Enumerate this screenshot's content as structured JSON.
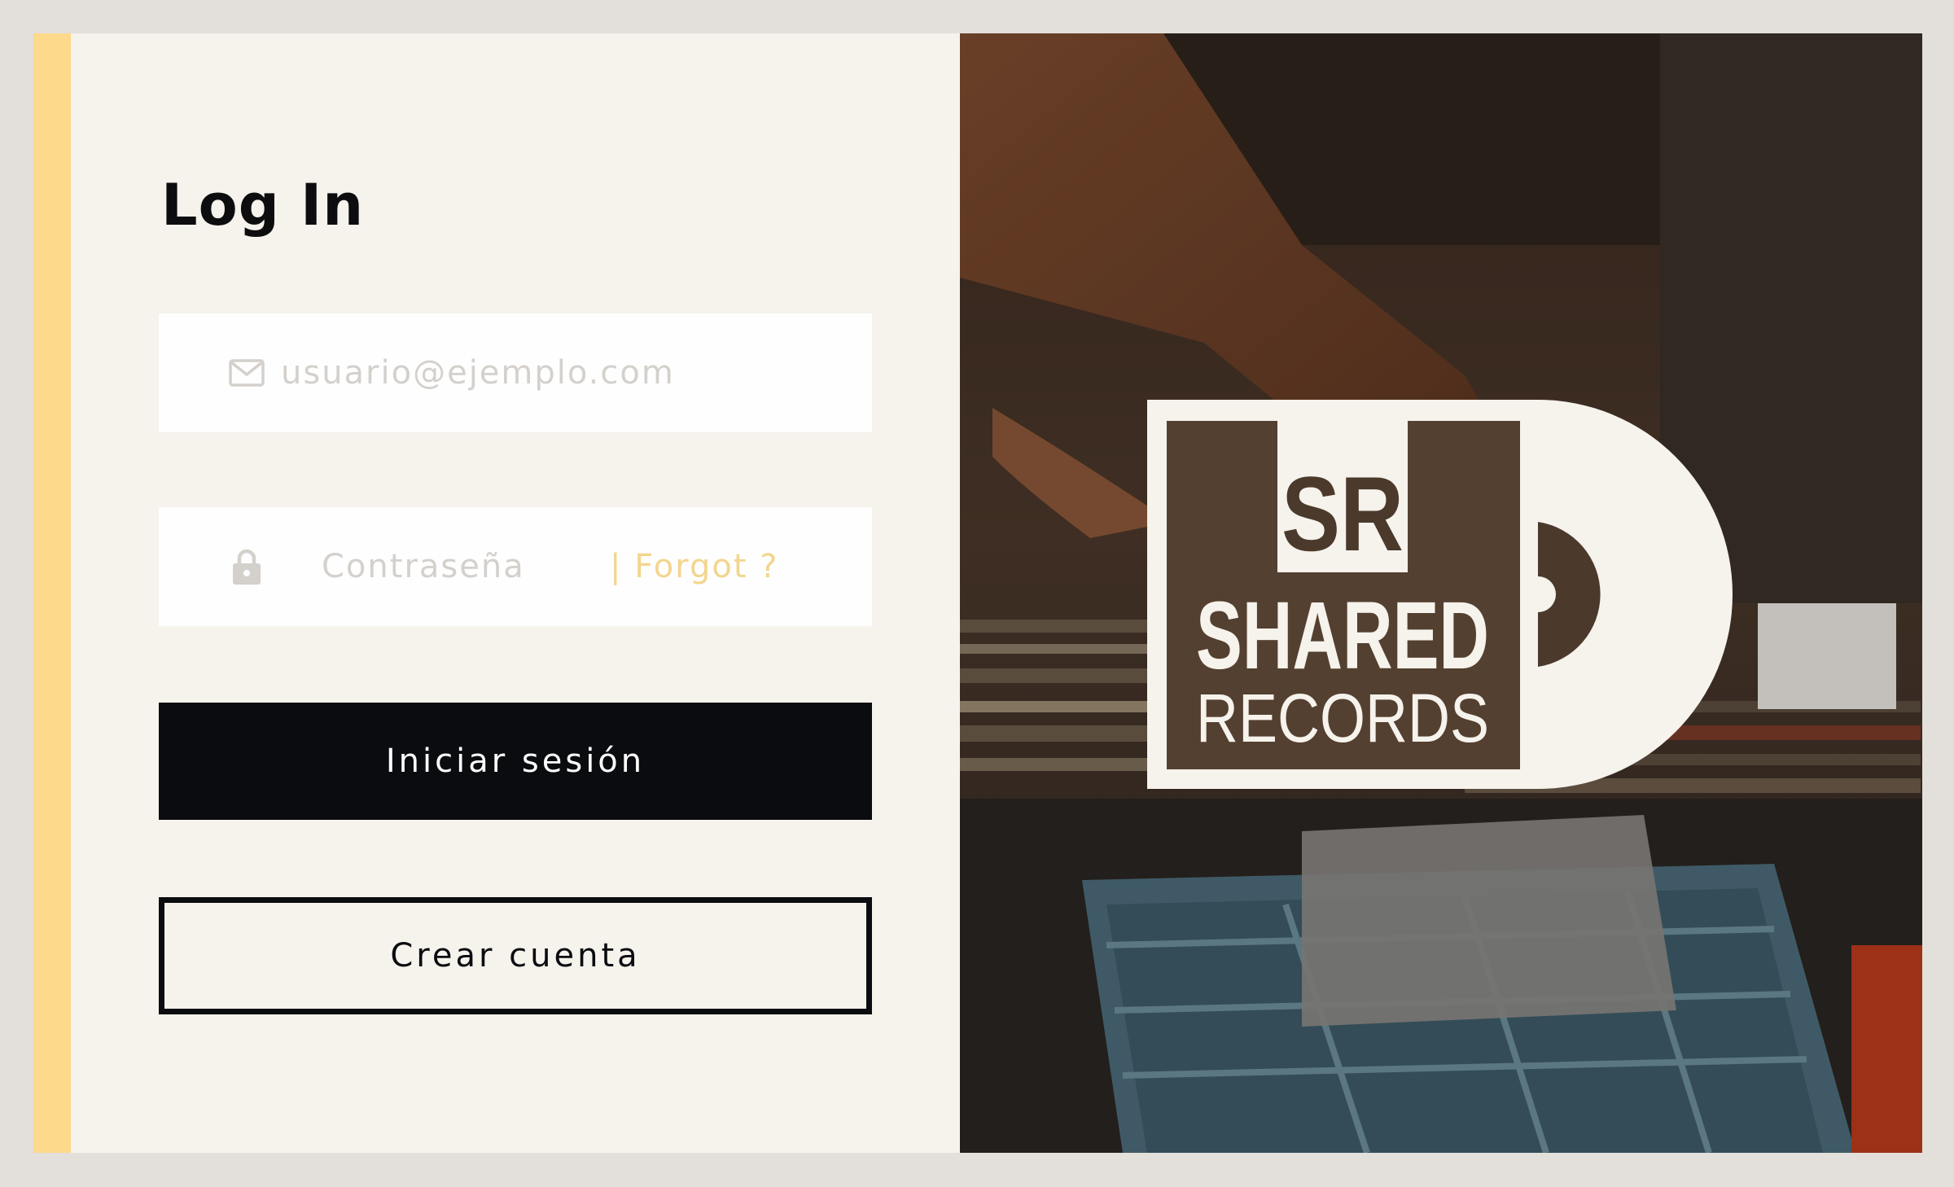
{
  "login": {
    "title": "Log In",
    "email": {
      "icon": "mail-icon",
      "placeholder": "usuario@ejemplo.com",
      "value": ""
    },
    "password": {
      "icon": "lock-icon",
      "placeholder": "Contraseña",
      "value": "",
      "forgot_label": "| Forgot ?"
    },
    "login_button": "Iniciar sesión",
    "create_button": "Crear cuenta"
  },
  "brand": {
    "monogram": "SR",
    "name_line1": "SHARED",
    "name_line2": "RECORDS"
  },
  "colors": {
    "accent": "#fdd98b",
    "panel_background": "#f6f2ec",
    "page_background": "#e3dfda",
    "primary_button": "#0b0c10",
    "forgot_link": "#f3d58f",
    "placeholder_text": "#d4d0cc"
  }
}
